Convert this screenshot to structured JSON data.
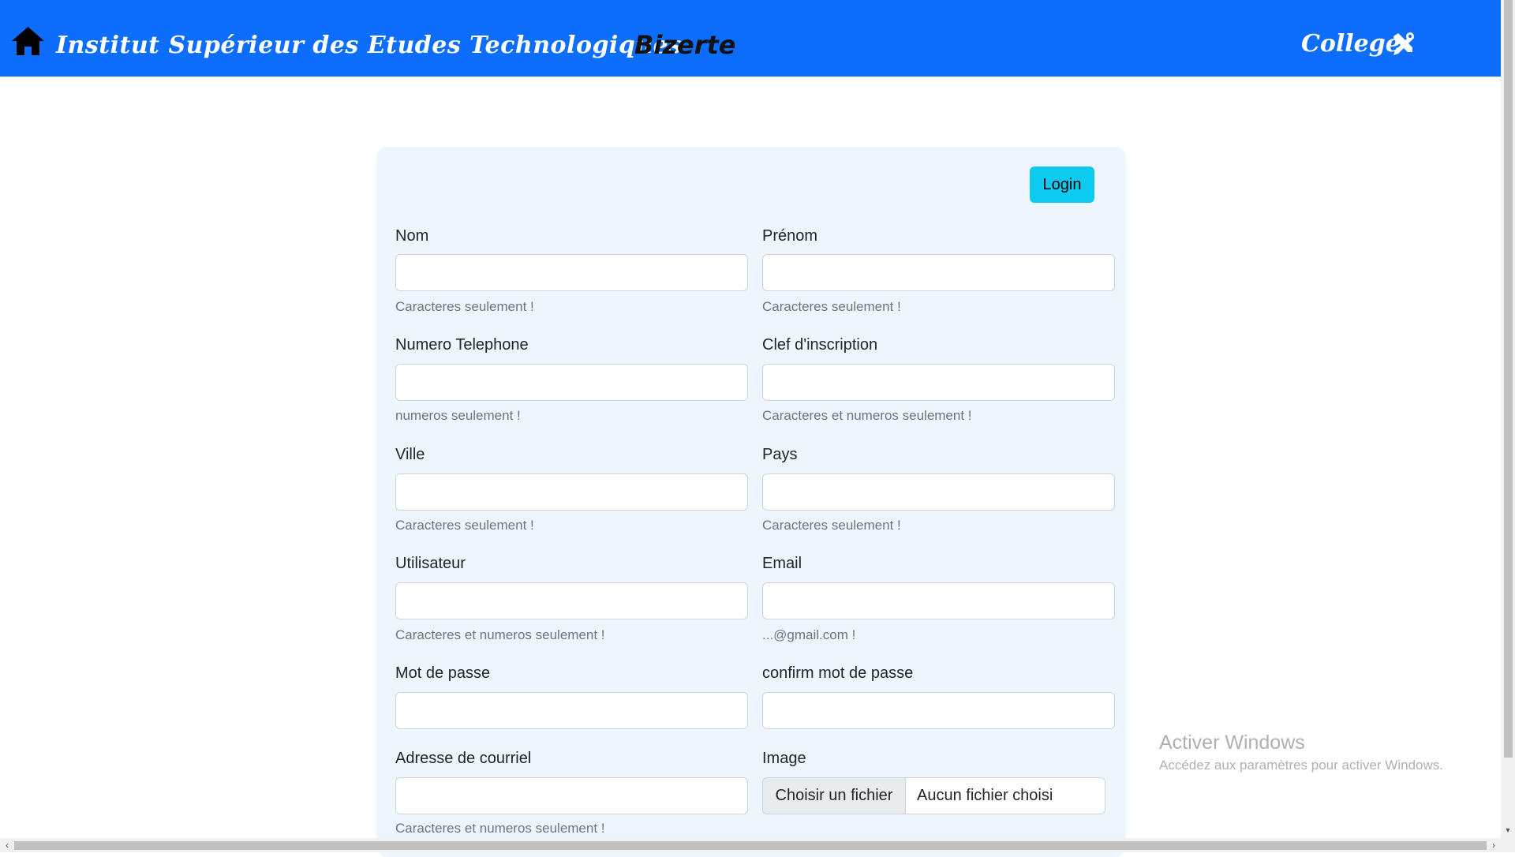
{
  "header": {
    "title": "Institut Supérieur des Etudes Technologiques",
    "title_accent": "Bizerte",
    "brand": "College",
    "home_icon": "home-icon",
    "brand_icon": "tools-icon",
    "background_color": "#0d6efd"
  },
  "form": {
    "login_label": "Login",
    "login_color": "#0dcaf0",
    "fields": {
      "nom": {
        "label": "Nom",
        "value": "",
        "help": "Caracteres seulement !"
      },
      "prenom": {
        "label": "Prénom",
        "value": "",
        "help": "Caracteres seulement !"
      },
      "telephone": {
        "label": "Numero Telephone",
        "value": "",
        "help": "numeros seulement !"
      },
      "clef": {
        "label": "Clef d'inscription",
        "value": "",
        "help": "Caracteres et numeros seulement !"
      },
      "ville": {
        "label": "Ville",
        "value": "",
        "help": "Caracteres seulement !"
      },
      "pays": {
        "label": "Pays",
        "value": "",
        "help": "Caracteres seulement !"
      },
      "utilisateur": {
        "label": "Utilisateur",
        "value": "",
        "help": "Caracteres et numeros seulement !"
      },
      "email": {
        "label": "Email",
        "value": "",
        "help": "...@gmail.com !"
      },
      "mot_de_passe": {
        "label": "Mot de passe",
        "value": ""
      },
      "confirm_mot_de_passe": {
        "label": "confirm mot de passe",
        "value": ""
      },
      "adresse": {
        "label": "Adresse de courriel",
        "value": "",
        "help": "Caracteres et numeros seulement !"
      },
      "image": {
        "label": "Image",
        "button": "Choisir un fichier",
        "status": "Aucun fichier choisi"
      }
    }
  },
  "watermark": {
    "title": "Activer Windows",
    "subtitle": "Accédez aux paramètres pour activer Windows."
  }
}
